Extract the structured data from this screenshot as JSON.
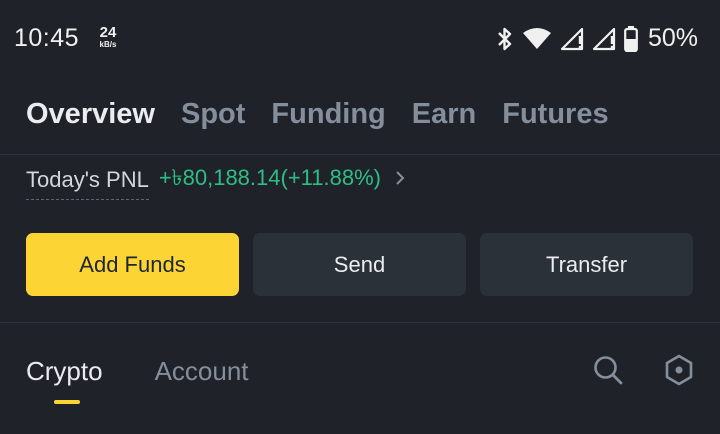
{
  "status_bar": {
    "time": "10:45",
    "net_speed_value": "24",
    "net_speed_unit": "kB/s",
    "battery": "50%",
    "icons": [
      "bluetooth-icon",
      "wifi-icon",
      "signal-icon",
      "signal-icon",
      "battery-icon"
    ]
  },
  "main_tabs": [
    {
      "label": "Overview",
      "active": true
    },
    {
      "label": "Spot",
      "active": false
    },
    {
      "label": "Funding",
      "active": false
    },
    {
      "label": "Earn",
      "active": false
    },
    {
      "label": "Futures",
      "active": false
    }
  ],
  "pnl": {
    "label": "Today's PNL",
    "value": "+৳80,188.14(+11.88%)",
    "color": "#2ebd85"
  },
  "actions": {
    "add_funds": "Add Funds",
    "send": "Send",
    "transfer": "Transfer"
  },
  "sub_tabs": [
    {
      "label": "Crypto",
      "active": true
    },
    {
      "label": "Account",
      "active": false
    }
  ],
  "sub_icons": [
    "search-icon",
    "settings-hexagon-icon"
  ],
  "colors": {
    "background": "#1f2329",
    "accent": "#fcd535",
    "positive": "#2ebd85",
    "muted": "#848e9c"
  }
}
